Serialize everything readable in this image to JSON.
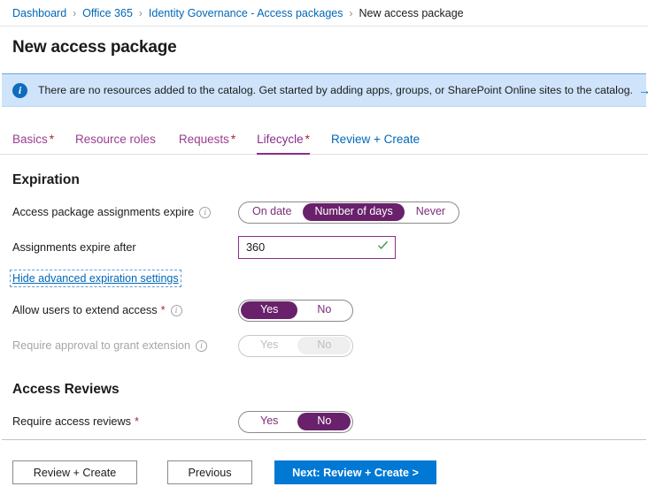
{
  "breadcrumb": {
    "separator": "›",
    "items": [
      {
        "label": "Dashboard",
        "current": false
      },
      {
        "label": "Office 365",
        "current": false
      },
      {
        "label": "Identity Governance - Access packages",
        "current": false
      },
      {
        "label": "New access package",
        "current": true
      }
    ]
  },
  "page": {
    "title": "New access package"
  },
  "banner": {
    "icon": "info-icon",
    "message": "There are no resources added to the catalog. Get started by adding apps, groups, or SharePoint Online sites to the catalog.",
    "arrow": "→",
    "background": "#cfe4fa",
    "accent": "#0f6cbd"
  },
  "tabs": [
    {
      "label": "Basics",
      "required": "*",
      "active": false,
      "style": "purple"
    },
    {
      "label": "Resource roles",
      "required": "",
      "active": false,
      "style": "purple"
    },
    {
      "label": "Requests",
      "required": "*",
      "active": false,
      "style": "purple"
    },
    {
      "label": "Lifecycle",
      "required": "*",
      "active": true,
      "style": "purple"
    },
    {
      "label": "Review + Create",
      "required": "",
      "active": false,
      "style": "blue"
    }
  ],
  "expiration": {
    "heading": "Expiration",
    "assignments_expire": {
      "label": "Access package assignments expire",
      "hint": "info-icon",
      "options": [
        {
          "label": "On date",
          "selected": false
        },
        {
          "label": "Number of days",
          "selected": true
        },
        {
          "label": "Never",
          "selected": false
        }
      ]
    },
    "expire_after": {
      "label": "Assignments expire after",
      "value": "360",
      "placeholder": "",
      "valid_icon": "checkmark-icon"
    },
    "advanced_link": "Hide advanced expiration settings",
    "allow_extend": {
      "label": "Allow users to extend access",
      "required": "*",
      "hint": "info-icon",
      "disabled": false,
      "options": [
        {
          "label": "Yes",
          "selected": true
        },
        {
          "label": "No",
          "selected": false
        }
      ]
    },
    "require_approval": {
      "label": "Require approval to grant extension",
      "required": "",
      "hint": "info-icon",
      "disabled": true,
      "options": [
        {
          "label": "Yes",
          "selected": false
        },
        {
          "label": "No",
          "selected": true
        }
      ]
    }
  },
  "access_reviews": {
    "heading": "Access Reviews",
    "require_reviews": {
      "label": "Require access reviews",
      "required": "*",
      "options": [
        {
          "label": "Yes",
          "selected": false
        },
        {
          "label": "No",
          "selected": true
        }
      ]
    }
  },
  "footer": {
    "review_create": "Review + Create",
    "previous": "Previous",
    "next": "Next: Review + Create >"
  },
  "colors": {
    "accent_purple": "#69216b",
    "tab_purple": "#9b3d8f",
    "link_blue": "#0067b8",
    "primary_blue": "#0078d4",
    "required_red": "#a4262c",
    "valid_green": "#3c9a3c"
  }
}
